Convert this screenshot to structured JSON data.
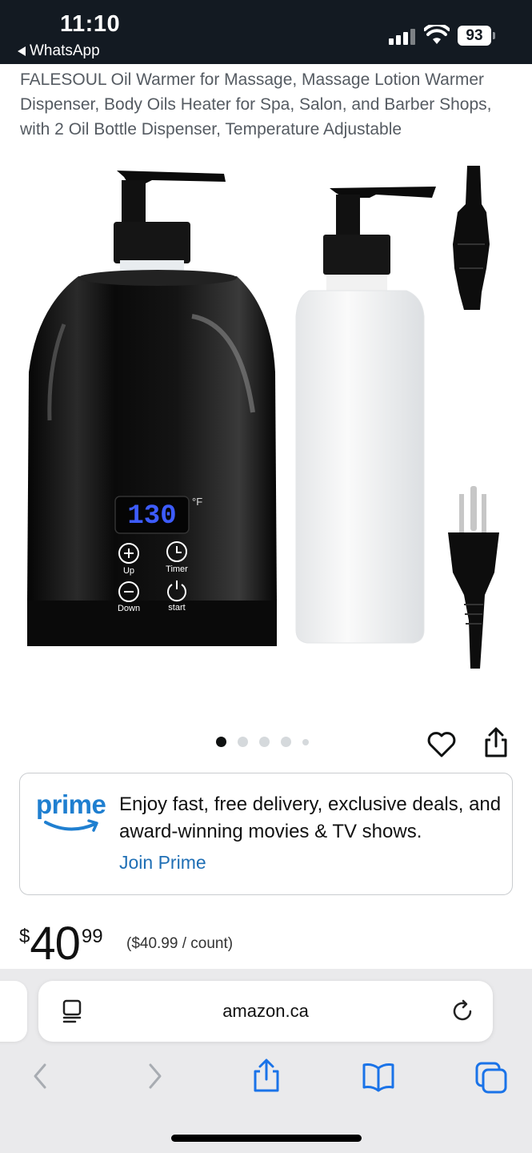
{
  "status_bar": {
    "time": "11:10",
    "back_app": "WhatsApp",
    "battery": "93",
    "icons": [
      "signal-icon",
      "wifi-icon",
      "battery-icon"
    ]
  },
  "product": {
    "title": "FALESOUL Oil Warmer for Massage, Massage Lotion Warmer Dispenser, Body Oils Heater for Spa, Salon, and Barber Shops, with 2 Oil Bottle Dispenser, Temperature Adjustable",
    "image": {
      "display_value": "130",
      "unit": "°F",
      "buttons": {
        "up": "Up",
        "timer": "Timer",
        "down": "Down",
        "start": "start"
      }
    },
    "carousel": {
      "total": 5,
      "active_index": 0
    },
    "actions": [
      "heart-icon",
      "share-icon"
    ]
  },
  "prime": {
    "logo": "prime",
    "text": "Enjoy fast, free delivery, exclusive deals, and award-winning movies & TV shows.",
    "link": "Join Prime"
  },
  "price": {
    "symbol": "$",
    "whole": "40",
    "fraction": "99",
    "unit_price": "($40.99 / count)"
  },
  "browser": {
    "url": "amazon.ca",
    "toolbar": [
      "back-icon",
      "forward-icon",
      "share-icon",
      "bookmarks-icon",
      "tabs-icon"
    ]
  },
  "colors": {
    "status_bar": "#131a22",
    "prime_blue": "#1f7fd0",
    "link_blue": "#1f6fb5",
    "safari_blue": "#1a73e8"
  }
}
